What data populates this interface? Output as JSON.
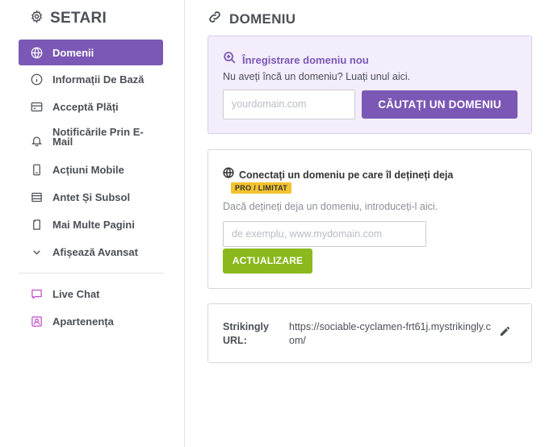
{
  "sidebar": {
    "title": "SETARI",
    "items": [
      {
        "label": "Domenii",
        "icon": "globe-icon"
      },
      {
        "label": "Informații De Bază",
        "icon": "info-icon"
      },
      {
        "label": "Acceptă Plăți",
        "icon": "card-icon"
      },
      {
        "label": "Notificările Prin E-Mail",
        "icon": "bell-icon"
      },
      {
        "label": "Acțiuni Mobile",
        "icon": "mobile-icon"
      },
      {
        "label": "Antet Și Subsol",
        "icon": "layout-icon"
      },
      {
        "label": "Mai Multe Pagini",
        "icon": "pages-icon"
      },
      {
        "label": "Afișează Avansat",
        "icon": "chevron-down-icon"
      }
    ],
    "apps": [
      {
        "label": "Live Chat",
        "icon": "chat-icon"
      },
      {
        "label": "Apartenența",
        "icon": "member-icon"
      }
    ]
  },
  "main": {
    "title": "DOMENIU",
    "register": {
      "heading": "Înregistrare domeniu nou",
      "subtitle": "Nu aveți încă un domeniu? Luați unul aici.",
      "placeholder": "yourdomain.com",
      "button": "CĂUTAȚI UN DOMENIU"
    },
    "connect": {
      "heading": "Conectați un domeniu pe care îl dețineți deja",
      "badge": "PRO / LIMITAT",
      "subtitle": "Dacă dețineți deja un domeniu, introduceți-l aici.",
      "placeholder": "de exemplu, www.mydomain.com",
      "button": "ACTUALIZARE"
    },
    "url": {
      "label": "Strikingly URL:",
      "value": "https://sociable-cyclamen-frt61j.mystrikingly.com/"
    }
  },
  "colors": {
    "accent": "#7b58b5",
    "accent_bg": "#f3edfc",
    "update_button": "#8bb81c",
    "badge": "#f3c22f",
    "app_icon": "#c04fc8"
  }
}
